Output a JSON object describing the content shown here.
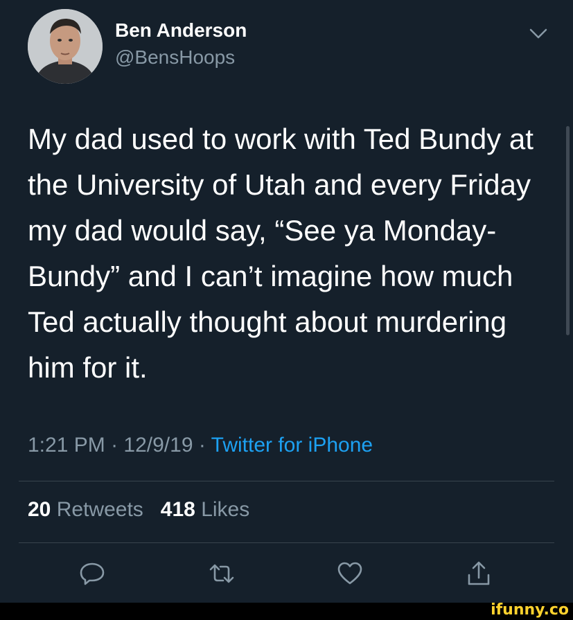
{
  "user": {
    "display_name": "Ben Anderson",
    "handle": "@BensHoops"
  },
  "tweet": {
    "text": "My dad used to work with Ted Bundy at the University of Utah and every Friday my dad would say, “See ya Monday-Bundy” and I can’t imagine how much Ted actually thought about murdering him for it.",
    "time": "1:21 PM",
    "separator": "·",
    "date": "12/9/19",
    "source": "Twitter for iPhone"
  },
  "stats": {
    "retweets_count": "20",
    "retweets_label": "Retweets",
    "likes_count": "418",
    "likes_label": "Likes"
  },
  "actions": {
    "reply_icon": "reply-bubble-icon",
    "retweet_icon": "retweet-icon",
    "like_icon": "heart-icon",
    "share_icon": "share-icon"
  },
  "watermark": "ifunny.co",
  "colors": {
    "background": "#15202b",
    "text_primary": "#ffffff",
    "text_secondary": "#8899a6",
    "accent": "#1da1f2",
    "divider": "#38444d",
    "watermark": "#ffd22e"
  }
}
